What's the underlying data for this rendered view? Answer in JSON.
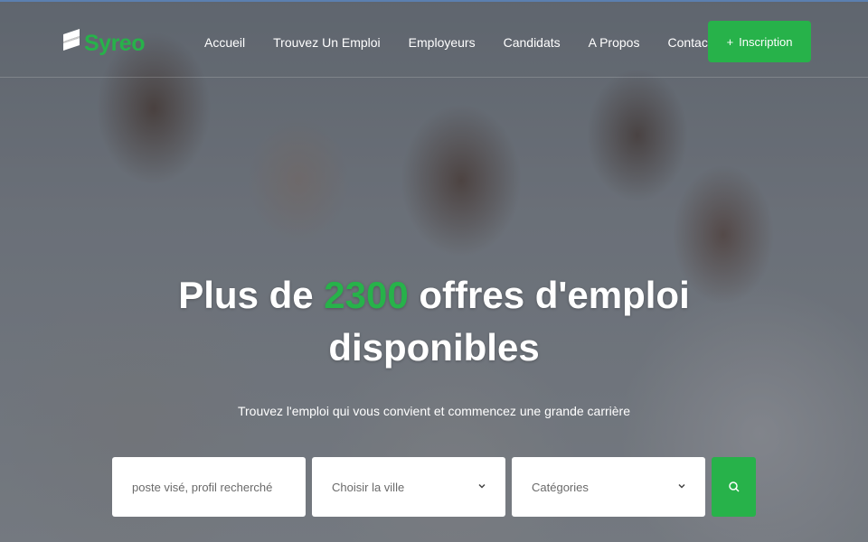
{
  "brand": {
    "name": "Syreo",
    "color": "#27b24a"
  },
  "nav": {
    "items": [
      {
        "label": "Accueil"
      },
      {
        "label": "Trouvez Un Emploi"
      },
      {
        "label": "Employeurs"
      },
      {
        "label": "Candidats"
      },
      {
        "label": "A Propos"
      },
      {
        "label": "Contact"
      }
    ]
  },
  "signup": {
    "icon": "plus-icon",
    "label": "Inscription"
  },
  "hero": {
    "headline_prefix": "Plus de ",
    "headline_number": "2300",
    "headline_suffix": " offres d'emploi disponibles",
    "subline": "Trouvez l'emploi qui vous convient et commencez une grande carrière"
  },
  "search": {
    "keyword_placeholder": "poste visé, profil recherché",
    "city_value": "Choisir la ville",
    "category_value": "Catégories",
    "button_icon": "search-icon"
  }
}
